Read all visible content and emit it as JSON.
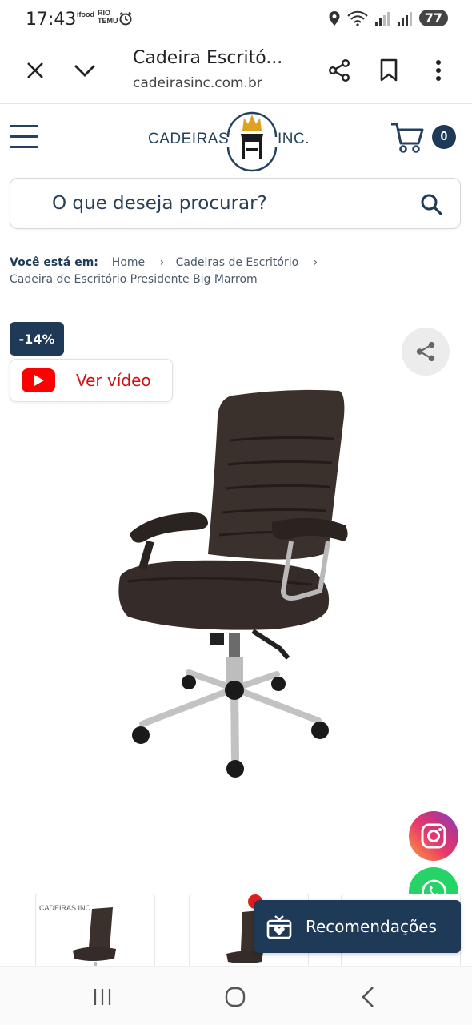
{
  "status_bar": {
    "time": "17:43",
    "mini_labels": [
      "ifood",
      "RIO",
      "TEMU"
    ],
    "battery": "77"
  },
  "browser": {
    "title": "Cadeira Escritó...",
    "url": "cadeirasinc.com.br",
    "icons": [
      "close-icon",
      "chevron-down-icon",
      "share-icon",
      "bookmark-icon",
      "more-vert-icon"
    ]
  },
  "header": {
    "logo_left": "CADEIRAS",
    "logo_right": "INC.",
    "cart_count": "0"
  },
  "search": {
    "placeholder": "O que deseja procurar?"
  },
  "breadcrumb": {
    "label": "Você está em:",
    "items": [
      "Home",
      "Cadeiras de Escritório",
      "Cadeira de Escritório Presidente Big Marrom"
    ]
  },
  "product": {
    "discount": "-14%",
    "video_label": "Ver vídeo",
    "thumb_logo": "CADEIRAS INC."
  },
  "recommendations": {
    "label": "Recomendações"
  },
  "colors": {
    "brand_navy": "#1e3a57",
    "youtube_red": "#ff0000",
    "whatsapp_green": "#25d366"
  }
}
